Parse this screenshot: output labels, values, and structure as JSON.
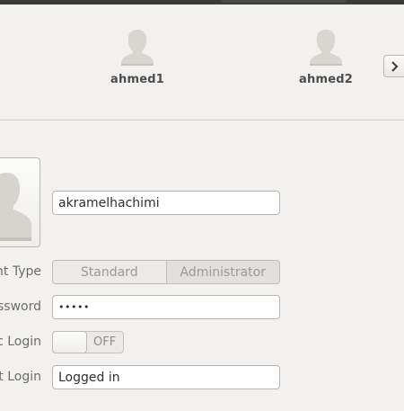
{
  "users": [
    {
      "name": "ahmed1",
      "icon": "user-avatar-icon"
    },
    {
      "name": "ahmed2",
      "icon": "user-avatar-icon"
    }
  ],
  "navigation": {
    "next_icon": "chevron-right-icon"
  },
  "account": {
    "avatar_icon": "user-avatar-icon",
    "full_name": "akramelhachimi",
    "account_type": {
      "label": "nt Type",
      "options": [
        "Standard",
        "Administrator"
      ],
      "selected": "Administrator"
    },
    "password": {
      "label": "ssword",
      "value": "•••••"
    },
    "automatic_login": {
      "label": "c Login",
      "state": "OFF"
    },
    "last_login": {
      "label": "t Login",
      "value": "Logged in"
    }
  },
  "colors": {
    "background": "#f2f1f0",
    "top_bar": "#3b3b38",
    "field_border": "#b7b5b2"
  }
}
